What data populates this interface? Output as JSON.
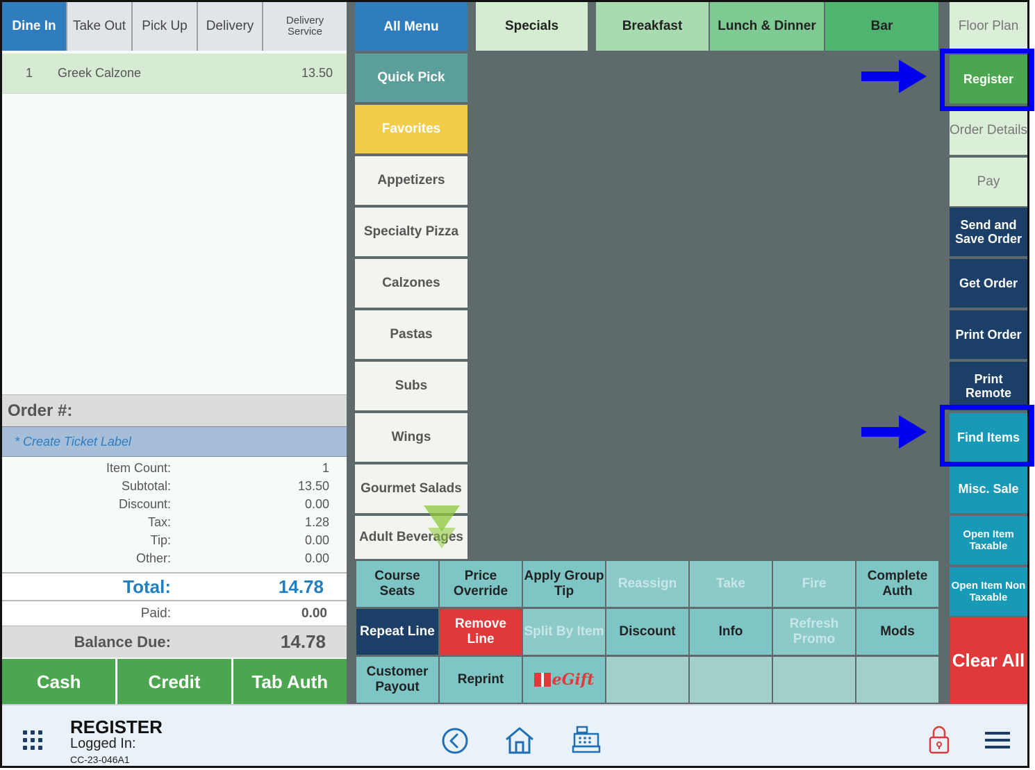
{
  "order_types": [
    "Dine In",
    "Take Out",
    "Pick Up",
    "Delivery",
    "Delivery Service"
  ],
  "order_line": {
    "qty": "1",
    "name": "Greek Calzone",
    "price": "13.50"
  },
  "order_number_label": "Order #:",
  "ticket_label": "* Create Ticket Label",
  "totals": {
    "item_count_label": "Item Count:",
    "item_count": "1",
    "subtotal_label": "Subtotal:",
    "subtotal": "13.50",
    "discount_label": "Discount:",
    "discount": "0.00",
    "tax_label": "Tax:",
    "tax": "1.28",
    "tip_label": "Tip:",
    "tip": "0.00",
    "other_label": "Other:",
    "other": "0.00",
    "total_label": "Total:",
    "total": "14.78",
    "paid_label": "Paid:",
    "paid": "0.00",
    "balance_label": "Balance Due:",
    "balance": "14.78"
  },
  "payment_buttons": [
    "Cash",
    "Credit",
    "Tab Auth"
  ],
  "categories": [
    "All Menu",
    "Quick Pick",
    "Favorites",
    "Appetizers",
    "Specialty Pizza",
    "Calzones",
    "Pastas",
    "Subs",
    "Wings",
    "Gourmet Salads",
    "Adult Beverages"
  ],
  "menu_tabs": [
    "Specials",
    "Breakfast",
    "Lunch & Dinner",
    "Bar"
  ],
  "actions": {
    "course_seats": "Course Seats",
    "price_override": "Price Override",
    "apply_group_tip": "Apply Group Tip",
    "reassign": "Reassign",
    "take": "Take",
    "fire": "Fire",
    "complete_auth": "Complete Auth",
    "repeat_line": "Repeat Line",
    "remove_line": "Remove Line",
    "split_by_item": "Split By Item",
    "discount": "Discount",
    "info": "Info",
    "refresh_promo": "Refresh Promo",
    "mods": "Mods",
    "customer_payout": "Customer Payout",
    "reprint": "Reprint",
    "egift": "eGift"
  },
  "right_buttons": {
    "floor_plan": "Floor Plan",
    "register": "Register",
    "order_details": "Order Details",
    "pay": "Pay",
    "send_save": "Send and Save Order",
    "get_order": "Get Order",
    "print_order": "Print Order",
    "print_remote": "Print Remote",
    "find_items": "Find Items",
    "misc_sale": "Misc. Sale",
    "open_item_taxable": "Open Item Taxable",
    "open_item_non_taxable": "Open Item Non Taxable",
    "clear_all": "Clear All"
  },
  "footer": {
    "app_name": "REGISTER",
    "logged_in": "Logged In:",
    "device_id": "CC-23-046A1"
  },
  "colors": {
    "primary_blue": "#2f7cbf",
    "green": "#4ca64f",
    "navy": "#1b3f67",
    "teal": "#1899b7",
    "red": "#e0393a",
    "annotation_blue": "#0000ee"
  }
}
